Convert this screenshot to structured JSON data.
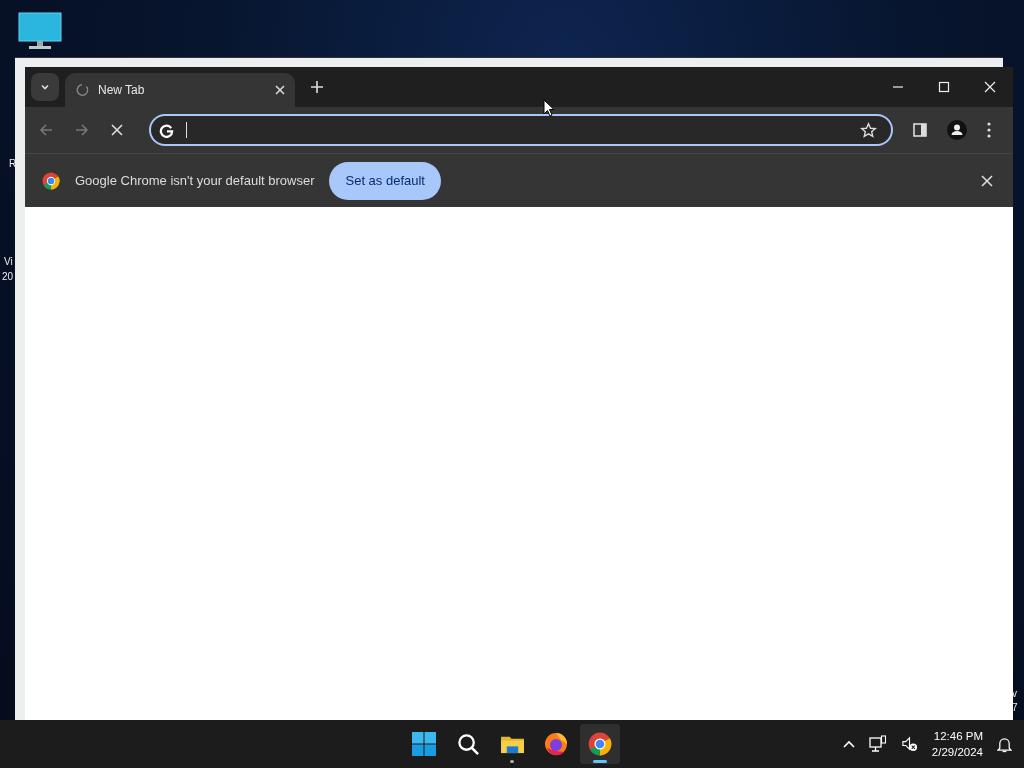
{
  "desktop_fragments": [
    "R",
    "Vi",
    "20",
    "v",
    "7"
  ],
  "browser": {
    "tabs": [
      {
        "title": "New Tab",
        "selected": true,
        "loading": true
      }
    ],
    "infobar": {
      "message": "Google Chrome isn't your default browser",
      "button": "Set as default"
    }
  },
  "taskbar": {
    "apps": [
      {
        "kind": "start",
        "selected": false,
        "running": false
      },
      {
        "kind": "search",
        "selected": false,
        "running": false
      },
      {
        "kind": "files",
        "selected": false,
        "running": true
      },
      {
        "kind": "firefox",
        "selected": false,
        "running": false
      },
      {
        "kind": "chrome",
        "selected": true,
        "running": true
      }
    ],
    "time": "12:46 PM",
    "date": "2/29/2024"
  }
}
